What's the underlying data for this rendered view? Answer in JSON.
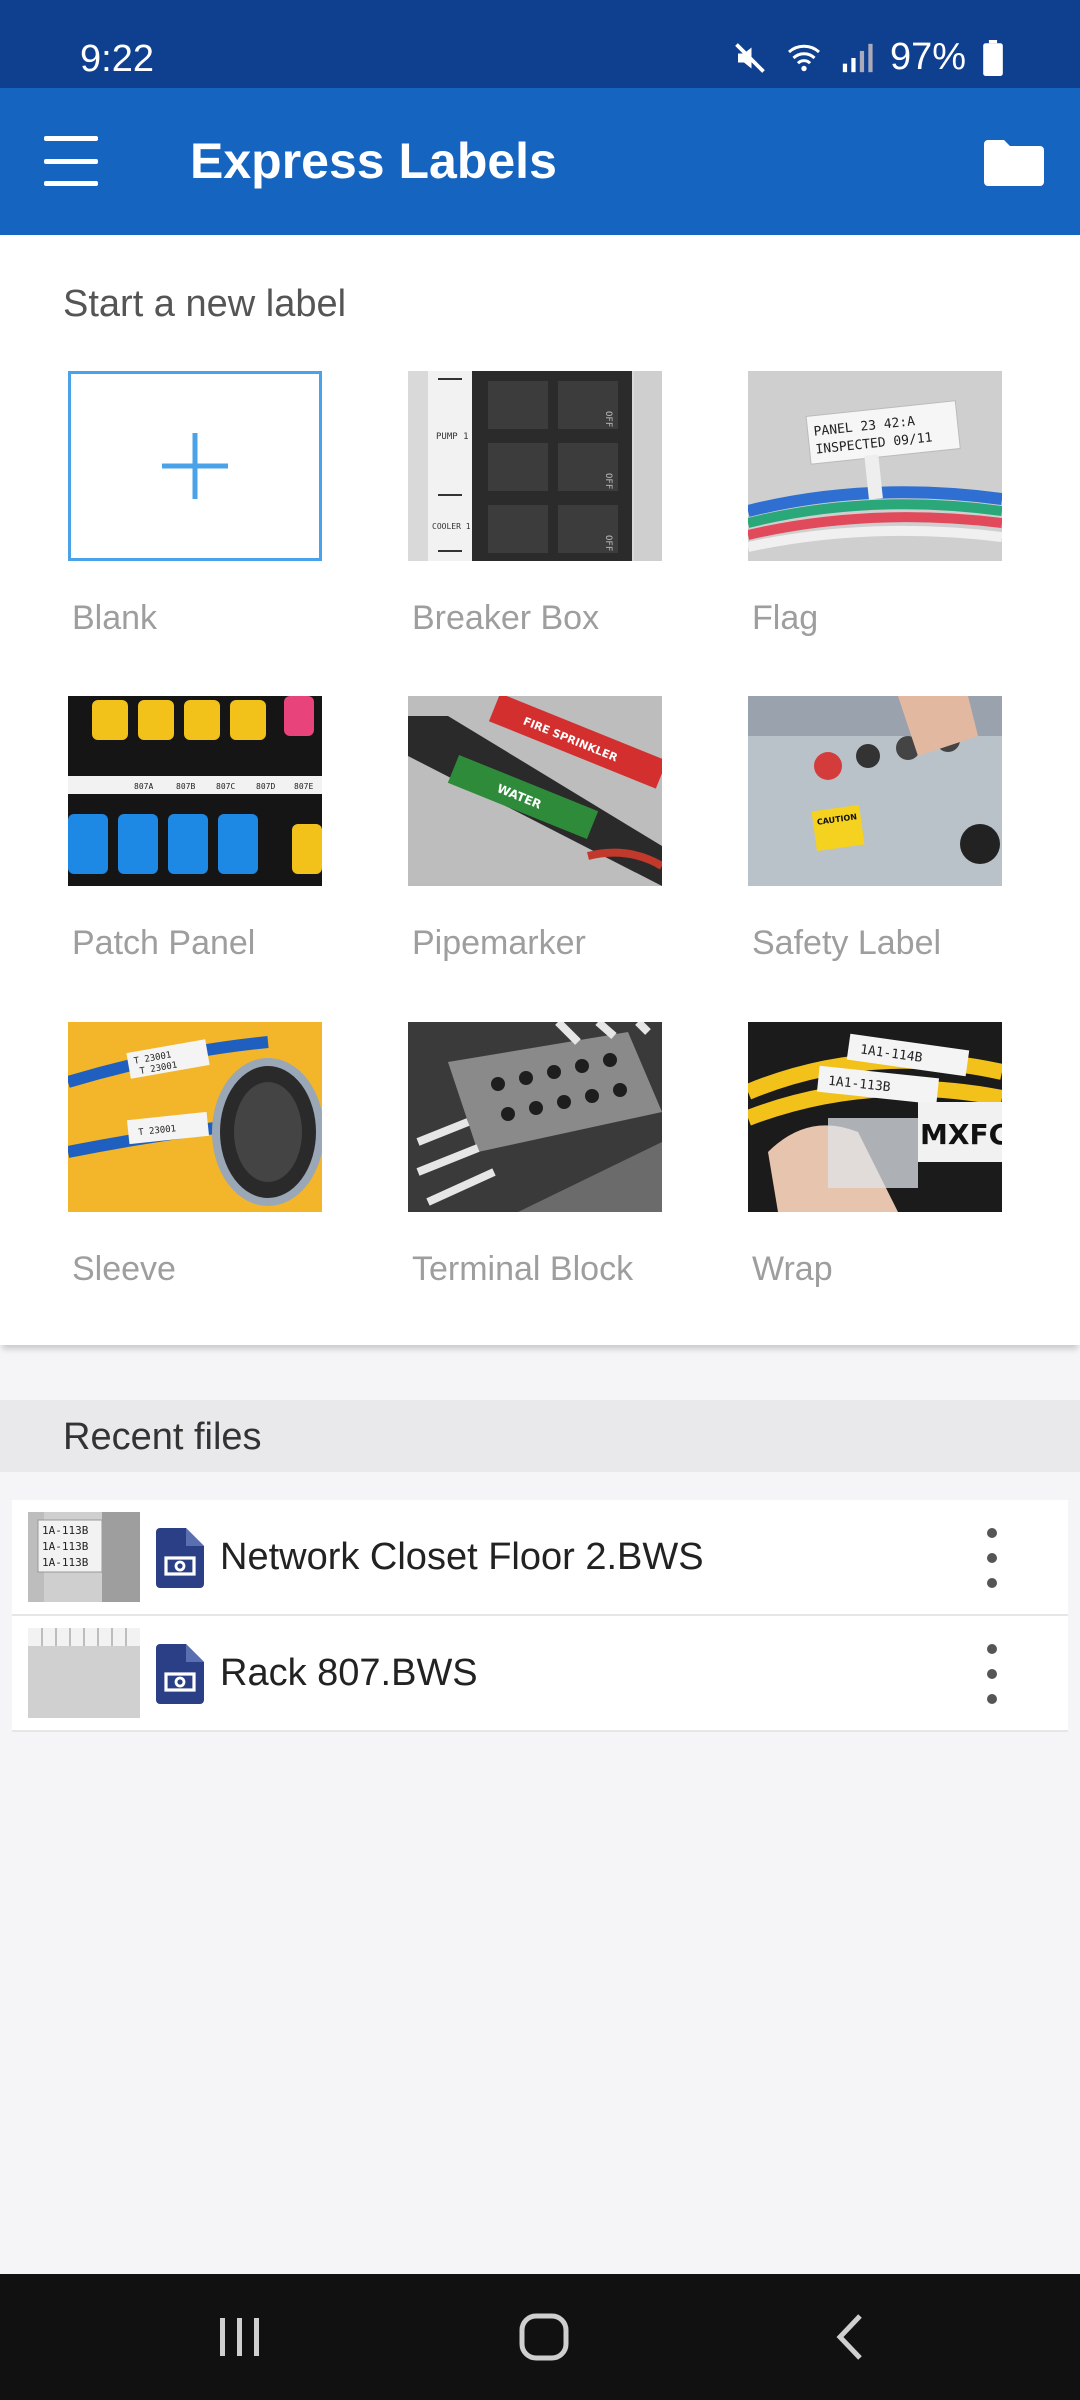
{
  "status_bar": {
    "time": "9:22",
    "battery": "97%",
    "icons": [
      "mute-icon",
      "wifi-icon",
      "signal-icon",
      "battery-icon"
    ]
  },
  "app_bar": {
    "title": "Express Labels",
    "menu_icon": "hamburger-icon",
    "folder_icon": "folder-icon"
  },
  "templates": {
    "title": "Start a new label",
    "items": [
      {
        "label": "Blank"
      },
      {
        "label": "Breaker Box",
        "thumb_text": [
          "PUMP 1",
          "COOLER 1",
          "OFF",
          "OFF",
          "OFF"
        ]
      },
      {
        "label": "Flag",
        "thumb_text": [
          "PANEL 23 42:A",
          "INSPECTED 09/11"
        ]
      },
      {
        "label": "Patch Panel",
        "thumb_text": [
          "807A",
          "807B",
          "807C",
          "807D",
          "807E"
        ]
      },
      {
        "label": "Pipemarker",
        "thumb_text": [
          "FIRE SPRINKLER",
          "WATER"
        ]
      },
      {
        "label": "Safety Label",
        "thumb_text": [
          "CAUTION"
        ]
      },
      {
        "label": "Sleeve",
        "thumb_text": [
          "T 23001",
          "T 23001",
          "T 23001"
        ]
      },
      {
        "label": "Terminal Block"
      },
      {
        "label": "Wrap",
        "thumb_text": [
          "1A1-114B",
          "1A1-113B",
          "MXFC"
        ]
      }
    ]
  },
  "recent": {
    "title": "Recent files",
    "files": [
      {
        "name": "Network Closet Floor 2.BWS",
        "thumb_text": [
          "1A-113B",
          "1A-113B",
          "1A-113B"
        ]
      },
      {
        "name": "Rack 807.BWS"
      }
    ]
  },
  "colors": {
    "status_bar": "#0f3f8f",
    "app_bar": "#1565c0",
    "accent": "#4aa3e8",
    "file_icon": "#2a3f86"
  }
}
